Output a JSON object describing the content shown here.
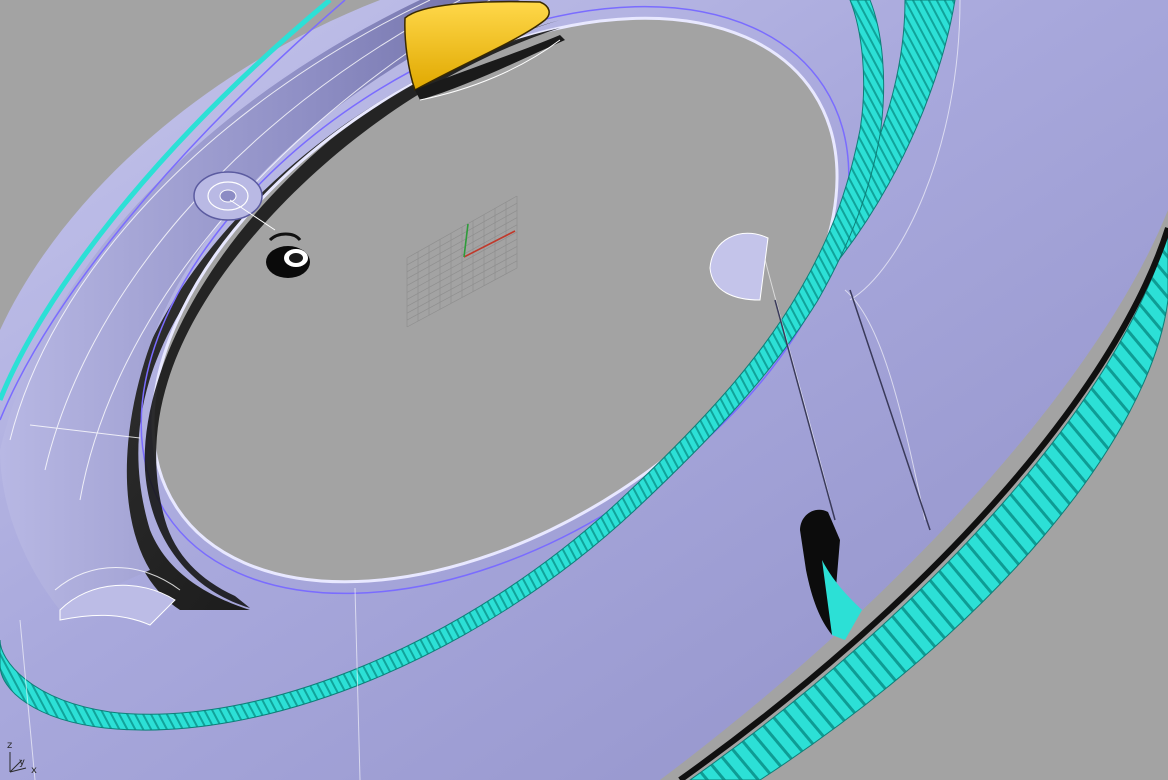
{
  "viewport": {
    "background_color": "#a3a3a3",
    "view": "perspective",
    "display_mode": "rendered"
  },
  "model": {
    "body_color": "#a6a6da",
    "body_highlight_color": "#d9d9f2",
    "isocurve_color": "#ffffff",
    "selected_edge_color": "#7a6cff",
    "gear_teeth_color": "#2ce0d6",
    "inner_dark_wall_color": "#1a1a1a",
    "selected_part_color": "#ffc41a",
    "components": [
      {
        "name": "outer-ring-body"
      },
      {
        "name": "inner-gear-ring"
      },
      {
        "name": "outer-gear-ring"
      },
      {
        "name": "inner-dark-wall"
      },
      {
        "name": "yellow-clip"
      },
      {
        "name": "bolt-fixture"
      },
      {
        "name": "round-mount"
      },
      {
        "name": "black-latch"
      },
      {
        "name": "side-bump"
      }
    ]
  },
  "construction_grid": {
    "line_color": "#8f8f8f",
    "x_axis_color": "#c0392b",
    "y_axis_color": "#2e9c3a"
  },
  "world_axes_icon": {
    "x_label": "x",
    "y_label": "y",
    "z_label": "z"
  }
}
